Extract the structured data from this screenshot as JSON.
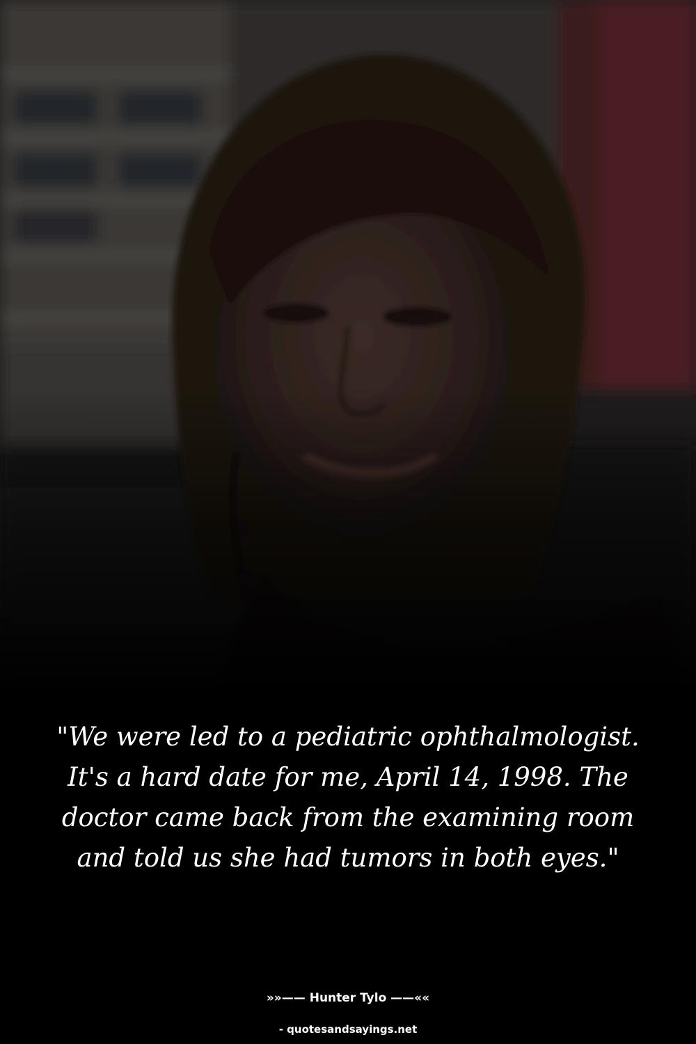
{
  "photo": {
    "subject": "smiling woman with dark hair and dangling earring",
    "overlay_color": "#000000"
  },
  "quote": {
    "text": "\"We were led to a pediatric ophthalmologist. It's a hard date for me, April 14, 1998. The doctor came back from the examining room and told us she had tumors in both eyes.\""
  },
  "author": {
    "text": "»»—— Hunter Tylo ——««"
  },
  "source": {
    "text": "- quotesandsayings.net"
  },
  "colors": {
    "background": "#000000",
    "text": "#ffffff"
  }
}
